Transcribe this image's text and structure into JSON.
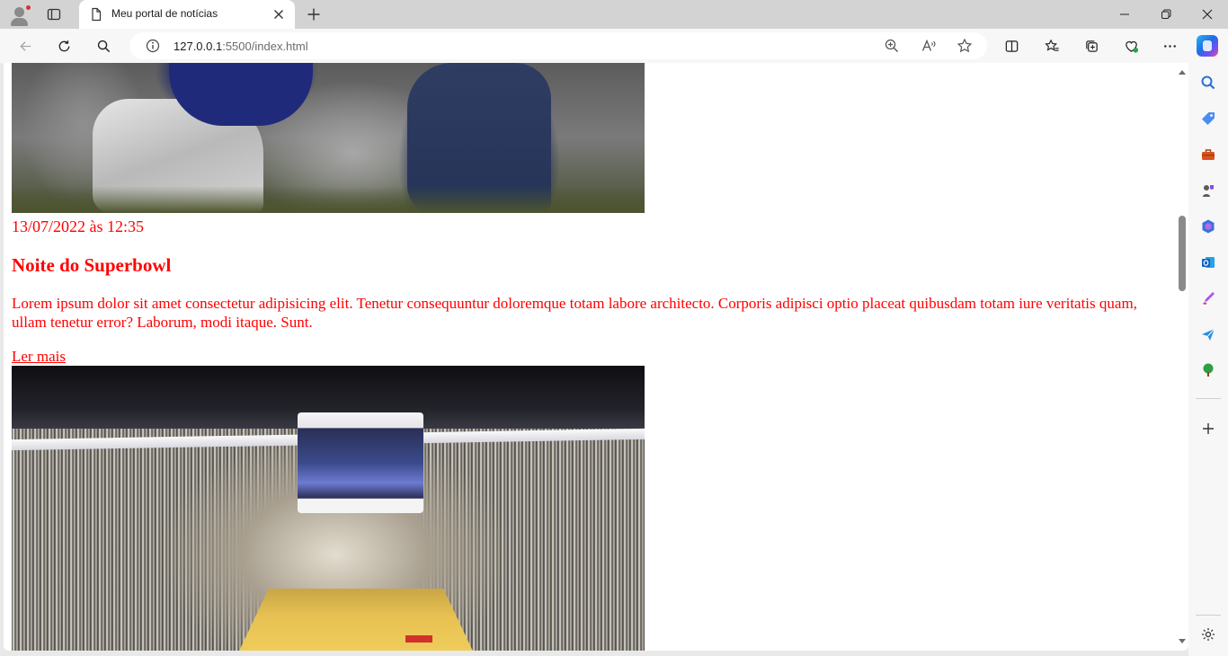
{
  "browser": {
    "tab": {
      "title": "Meu portal de notícias"
    },
    "address": {
      "host": "127.0.0.1",
      "rest": ":5500/index.html"
    }
  },
  "article": {
    "timestamp": "13/07/2022 às 12:35",
    "headline": "Noite do Superbowl",
    "body": "Lorem ipsum dolor sit amet consectetur adipisicing elit. Tenetur consequuntur doloremque totam labore architecto. Corporis adipisci optio placeat quibusdam totam iure veritatis quam, ullam tenetur error? Laborum, modi itaque. Sunt.",
    "read_more": "Ler mais"
  },
  "colors": {
    "text_accent": "#ff0000",
    "tab_strip": "#d3d3d3",
    "toolbar": "#f7f7f7",
    "scroll_thumb": "#8a8a8a"
  },
  "icons": {
    "tab_strip": [
      "profile-icon",
      "tab-actions-icon",
      "page-icon",
      "tab-close-icon",
      "new-tab-icon"
    ],
    "window": [
      "minimize-icon",
      "restore-icon",
      "close-window-icon"
    ],
    "toolbar": [
      "back-icon",
      "refresh-icon",
      "search-icon",
      "info-icon",
      "zoom-icon",
      "read-aloud-icon",
      "favorite-star-icon",
      "split-screen-icon",
      "favorites-icon",
      "collections-icon",
      "browser-essentials-icon",
      "more-icon",
      "copilot-icon"
    ],
    "sidebar": [
      "search-icon",
      "shopping-tag-icon",
      "toolbox-icon",
      "games-icon",
      "microsoft-365-icon",
      "outlook-icon",
      "designer-icon",
      "send-icon",
      "tree-icon",
      "add-icon",
      "settings-icon"
    ]
  }
}
